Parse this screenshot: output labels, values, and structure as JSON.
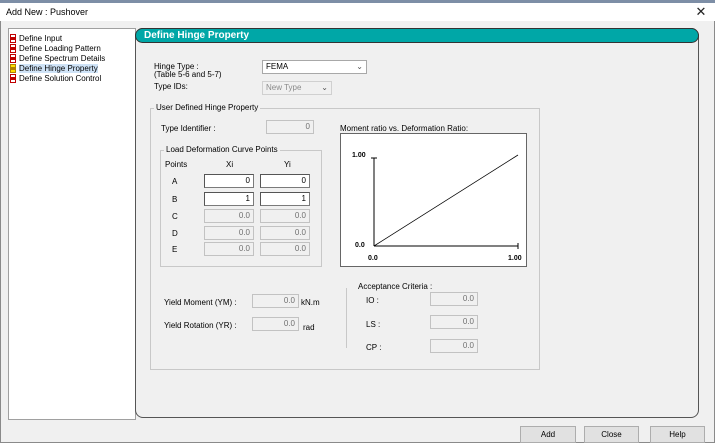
{
  "window": {
    "title": "Add New : Pushover",
    "close": "✕"
  },
  "tree": {
    "items": [
      {
        "label": "Define Input",
        "active": false
      },
      {
        "label": "Define Loading Pattern",
        "active": false
      },
      {
        "label": "Define Spectrum Details",
        "active": false
      },
      {
        "label": "Define Hinge Property",
        "active": true
      },
      {
        "label": "Define Solution Control",
        "active": false
      }
    ]
  },
  "panel": {
    "title": "Define Hinge Property"
  },
  "hinge": {
    "type_label": "Hinge Type :",
    "type_sublabel": "(Table 5-6 and 5-7)",
    "type_value": "FEMA",
    "ids_label": "Type IDs:",
    "ids_value": "New Type"
  },
  "user_defined": {
    "group_title": "User Defined Hinge Property",
    "type_identifier_label": "Type Identifier :",
    "type_identifier_value": "0",
    "curve": {
      "group_title": "Load Deformation Curve Points",
      "col_points": "Points",
      "col_xi": "Xi",
      "col_yi": "Yi",
      "rows": [
        {
          "point": "A",
          "xi": "0",
          "yi": "0",
          "editable": true
        },
        {
          "point": "B",
          "xi": "1",
          "yi": "1",
          "editable": true
        },
        {
          "point": "C",
          "xi": "0.0",
          "yi": "0.0",
          "editable": false
        },
        {
          "point": "D",
          "xi": "0.0",
          "yi": "0.0",
          "editable": false
        },
        {
          "point": "E",
          "xi": "0.0",
          "yi": "0.0",
          "editable": false
        }
      ]
    },
    "plot": {
      "title": "Moment ratio vs. Deformation Ratio:",
      "y_max": "1.00",
      "y_min": "0.0",
      "x_min": "0.0",
      "x_max": "1.00"
    },
    "yield_moment_label": "Yield Moment (YM) :",
    "yield_moment_value": "0.0",
    "yield_moment_unit": "kN.m",
    "yield_rotation_label": "Yield Rotation (YR) :",
    "yield_rotation_value": "0.0",
    "yield_rotation_unit": "rad",
    "acceptance": {
      "title": "Acceptance Criteria :",
      "io_label": "IO :",
      "io_value": "0.0",
      "ls_label": "LS :",
      "ls_value": "0.0",
      "cp_label": "CP :",
      "cp_value": "0.0"
    }
  },
  "buttons": {
    "add": "Add",
    "close": "Close",
    "help": "Help"
  },
  "colors": {
    "header": "#00a7a7",
    "titlebar_strip": "#7d8ea6"
  }
}
